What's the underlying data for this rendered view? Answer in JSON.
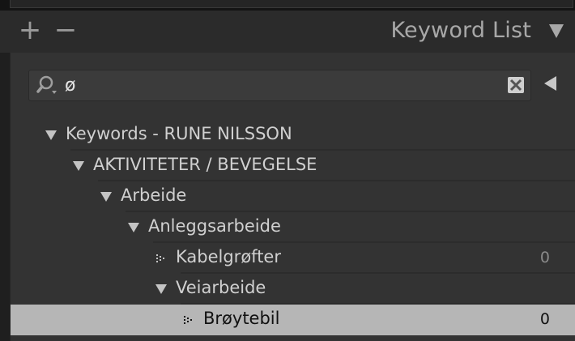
{
  "header": {
    "add_label": "+",
    "remove_label": "−",
    "title": "Keyword List"
  },
  "search": {
    "value": "ø"
  },
  "tree": [
    {
      "label": "Keywords - RUNE NILSSON",
      "level": 0,
      "expanded": true
    },
    {
      "label": "AKTIVITETER / BEVEGELSE",
      "level": 1,
      "expanded": true
    },
    {
      "label": "Arbeide",
      "level": 2,
      "expanded": true
    },
    {
      "label": "Anleggsarbeide",
      "level": 3,
      "expanded": true
    },
    {
      "label": "Kabelgrøfter",
      "level": 4,
      "leaf": true,
      "count": "0"
    },
    {
      "label": "Veiarbeide",
      "level": 4,
      "expanded": true
    },
    {
      "label": "Brøytebil",
      "level": 5,
      "leaf": true,
      "count": "0",
      "selected": true
    }
  ],
  "colors": {
    "panel": "#333333",
    "header": "#2b2b2b",
    "selected_row": "#b6b6b6",
    "text": "#d0d0d0"
  }
}
